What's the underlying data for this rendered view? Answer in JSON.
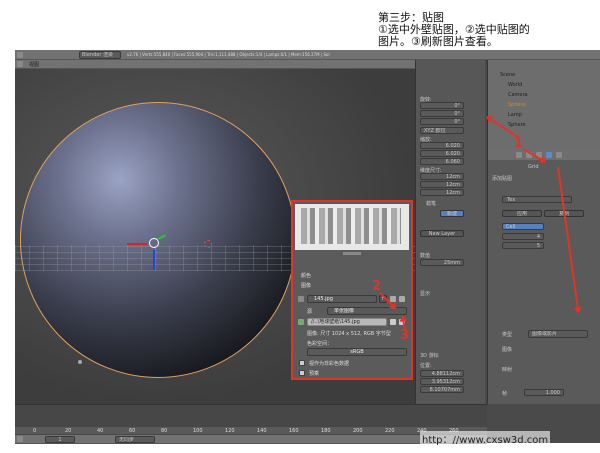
{
  "annotation": {
    "line1": "第三步：贴图",
    "line2": "①选中外壁贴图，②选中贴图的",
    "line3": "图片。③刷新图片查看。"
  },
  "markers": {
    "m1": "1",
    "m2": "2",
    "m3": "3"
  },
  "top_bar": {
    "render_engine": "Blender 渲染",
    "stats": "v2.76 | Verts:555,840 | Faces:555,904 | Tris:1,111,488 | Objects:1/4 | Lamps:0/1 | Mem:156.37M | Sol"
  },
  "viewport": {
    "view_label": "视图"
  },
  "image_panel": {
    "tab_image": "图像",
    "tab_brush": "画笔",
    "new_layer": "New Layer",
    "section_color": "颜色",
    "section_image": "图像",
    "image_name": "145.jpg",
    "fake_user": "F",
    "source_label": "源",
    "source_value": "单张图像",
    "filepath": "//..\\地球壁纸\\145.jpg",
    "image_info": "图像: 尺寸 1024 x 512, RGB 字节型",
    "color_space_label": "色彩空间：",
    "color_space_value": "sRGB",
    "opt1": "视作为非彩色数据",
    "opt2": "预乘"
  },
  "right_panel": {
    "rotation_label": "旋转:",
    "rx": "0°",
    "ry": "0°",
    "rz": "0°",
    "mode": "XYZ 欧拉",
    "scale_label": "缩放:",
    "sx": "6.020",
    "sy": "6.020",
    "sz": "6.060",
    "dims_label": "维度尺寸:",
    "dx": "12cm",
    "dy": "12cm",
    "dz": "12cm",
    "grease_label": "蜡笔",
    "new_btn": "新建",
    "new_layer": "New Layer",
    "value_label": "数值",
    "value": "25mm",
    "show_label": "显示",
    "d3_label": "3D 游标",
    "loc_label": "位置:",
    "lx": "4.88112cm",
    "ly": "3.95312cm",
    "lz": "8.10707mm"
  },
  "outliner": {
    "scene": "Scene",
    "items": [
      "World",
      "Camera",
      "Sphere",
      "Lamp",
      "Sphere"
    ]
  },
  "props": {
    "obj": "Grid",
    "mat": "材质",
    "slot": "添加贴图",
    "tex": "Tex",
    "apply": "应用",
    "btn2": "复制",
    "other": "Cell",
    "val4": "4",
    "val5": "5",
    "type_label": "类型",
    "type_val": "图像或影片",
    "image_section": "图像",
    "mapping": "映射",
    "frame": "帧",
    "frame_val": "1.000"
  },
  "timeline": {
    "start": "1",
    "marks": [
      "0",
      "20",
      "40",
      "60",
      "80",
      "100",
      "120",
      "140",
      "160",
      "180",
      "200",
      "220",
      "240",
      "260"
    ],
    "mode": "无同步"
  },
  "watermark": "http：//www.cxsw3d.com"
}
